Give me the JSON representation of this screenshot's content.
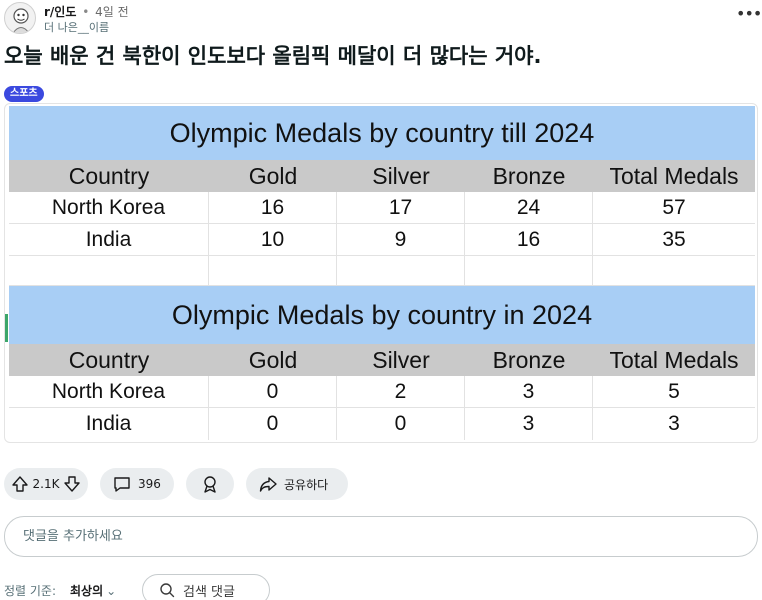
{
  "post": {
    "subreddit": "r/인도",
    "separator": "•",
    "time": "4일 전",
    "author": "더 나은__이름",
    "more_label": "•••",
    "title": "오늘 배운 건 북한이 인도보다 올림픽 메달이 더 많다는 거야.",
    "flair": "스포츠"
  },
  "image": {
    "tables": [
      {
        "title": "Olympic Medals by country till 2024",
        "headers": [
          "Country",
          "Gold",
          "Silver",
          "Bronze",
          "Total Medals"
        ],
        "rows": [
          [
            "North Korea",
            "16",
            "17",
            "24",
            "57"
          ],
          [
            "India",
            "10",
            "9",
            "16",
            "35"
          ]
        ]
      },
      {
        "title": "Olympic Medals by country in 2024",
        "headers": [
          "Country",
          "Gold",
          "Silver",
          "Bronze",
          "Total Medals"
        ],
        "rows": [
          [
            "North Korea",
            "0",
            "2",
            "3",
            "5"
          ],
          [
            "India",
            "0",
            "0",
            "3",
            "3"
          ]
        ]
      }
    ]
  },
  "actions": {
    "vote_count": "2.1K",
    "comment_count": "396",
    "share_label": "공유하다"
  },
  "comment_input": {
    "placeholder": "댓글을 추가하세요"
  },
  "sort": {
    "label": "정렬 기준:",
    "selected": "최상의",
    "search_label": "검색 댓글"
  },
  "colors": {
    "flair_bg": "#3b49df",
    "table_title_bg": "#a8cef5",
    "table_header_bg": "#c9c9c9",
    "pill_bg": "#eaedef"
  }
}
